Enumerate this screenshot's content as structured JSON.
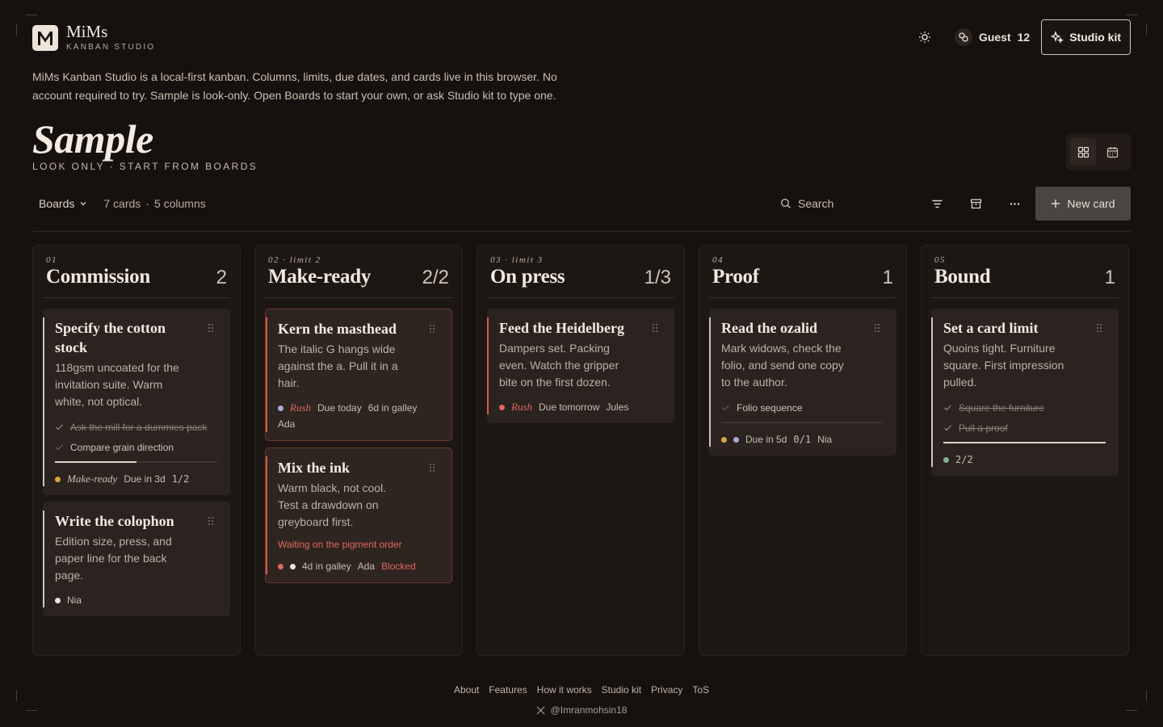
{
  "app": {
    "name": "MiMs",
    "subtitle": "KANBAN STUDIO",
    "logo_letter": "M"
  },
  "header": {
    "guest_label": "Guest",
    "guest_count": "12",
    "studio_kit_label": "Studio kit"
  },
  "intro": "MiMs Kanban Studio is a local-first kanban. Columns, limits, due dates, and cards live in this browser. No account required to try. Sample is look-only. Open Boards to start your own, or ask Studio kit to type one.",
  "page": {
    "title": "Sample",
    "subtitle": "LOOK ONLY · START FROM BOARDS"
  },
  "toolbar": {
    "boards_label": "Boards",
    "cards_count": "7 cards",
    "separator": "·",
    "columns_count": "5 columns",
    "search_placeholder": "Search",
    "new_card_label": "New card"
  },
  "columns": [
    {
      "meta": "01",
      "title": "Commission",
      "count": "2",
      "cards": [
        {
          "title": "Specify the cotton stock",
          "desc": "118gsm uncoated for the invitation suite. Warm white, not optical.",
          "checklist": [
            {
              "text": "Ask the mill for a dummies pack",
              "done": true
            },
            {
              "text": "Compare grain direction",
              "done": false
            }
          ],
          "progress": 0.5,
          "stage": "Make-ready",
          "due": "Due in 3d",
          "tally": "1/2"
        },
        {
          "title": "Write the colophon",
          "desc": "Edition size, press, and paper line for the back page.",
          "assignee": "Nia"
        }
      ]
    },
    {
      "meta": "02 · limit 2",
      "title": "Make-ready",
      "count": "2/2",
      "cards": [
        {
          "title": "Kern the masthead",
          "desc": "The italic G hangs wide against the a. Pull it in a hair.",
          "tag": "Rush",
          "due": "Due today",
          "galley": "6d in galley",
          "assignee": "Ada"
        },
        {
          "title": "Mix the ink",
          "desc": "Warm black, not cool. Test a drawdown on greyboard first.",
          "waiting": "Waiting on the pigment order",
          "galley": "4d in galley",
          "assignee": "Ada",
          "status": "Blocked"
        }
      ]
    },
    {
      "meta": "03 · limit 3",
      "title": "On press",
      "count": "1/3",
      "cards": [
        {
          "title": "Feed the Heidelberg",
          "desc": "Dampers set. Packing even. Watch the gripper bite on the first dozen.",
          "tag": "Rush",
          "due": "Due tomorrow",
          "assignee": "Jules"
        }
      ]
    },
    {
      "meta": "04",
      "title": "Proof",
      "count": "1",
      "cards": [
        {
          "title": "Read the ozalid",
          "desc": "Mark widows, check the folio, and send one copy to the author.",
          "checklist": [
            {
              "text": "Folio sequence",
              "done": false
            }
          ],
          "progress": 0,
          "due": "Due in 5d",
          "tally": "0/1",
          "assignee": "Nia"
        }
      ]
    },
    {
      "meta": "05",
      "title": "Bound",
      "count": "1",
      "cards": [
        {
          "title": "Set a card limit",
          "desc": "Quoins tight. Furniture square. First impression pulled.",
          "checklist": [
            {
              "text": "Square the furniture",
              "done": true
            },
            {
              "text": "Pull a proof",
              "done": true
            }
          ],
          "progress": 1,
          "tally": "2/2"
        }
      ]
    }
  ],
  "footer": {
    "links": [
      "About",
      "Features",
      "How it works",
      "Studio kit",
      "Privacy",
      "ToS"
    ],
    "handle": "@Imranmohsin18"
  },
  "colors": {
    "background": "#16110e",
    "rush": "#e0675b",
    "dot_amber": "#d9a441",
    "dot_lavender": "#a6acd8",
    "dot_sage": "#8fae8f",
    "dot_white": "#ece4d8"
  }
}
